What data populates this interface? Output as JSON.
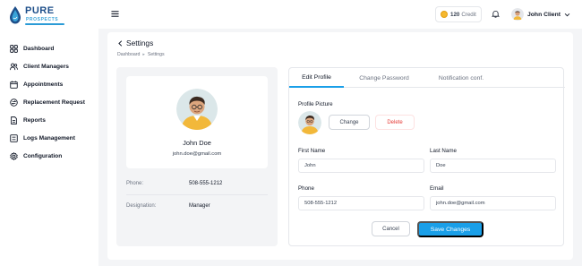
{
  "brand": {
    "name": "PURE",
    "tagline": "PROSPECTS",
    "colors": {
      "primary": "#1a9fe8",
      "brand_dark": "#1e4f8a",
      "danger": "#e53935"
    }
  },
  "sidebar": {
    "items": [
      {
        "label": "Dashboard",
        "icon": "grid-icon"
      },
      {
        "label": "Client Managers",
        "icon": "users-icon"
      },
      {
        "label": "Appointments",
        "icon": "calendar-icon"
      },
      {
        "label": "Replacement Request",
        "icon": "swap-icon"
      },
      {
        "label": "Reports",
        "icon": "document-icon"
      },
      {
        "label": "Logs Management",
        "icon": "list-icon"
      },
      {
        "label": "Configuration",
        "icon": "gear-icon"
      }
    ]
  },
  "header": {
    "credit_value": "120",
    "credit_label": "Credit",
    "user_name": "John Client"
  },
  "page": {
    "title": "Settings",
    "breadcrumb": [
      "Dashboard",
      "Settings"
    ]
  },
  "profile": {
    "name": "John Doe",
    "email": "john.doe@gmail.com",
    "phone_label": "Phone:",
    "phone": "508-555-1212",
    "designation_label": "Designation:",
    "designation": "Manager"
  },
  "tabs": [
    {
      "label": "Edit Profile",
      "active": true
    },
    {
      "label": "Change Password",
      "active": false
    },
    {
      "label": "Notification conf.",
      "active": false
    }
  ],
  "form": {
    "picture_label": "Profile Picture",
    "change_label": "Change",
    "delete_label": "Delete",
    "first_name_label": "First Name",
    "first_name_value": "John",
    "last_name_label": "Last Name",
    "last_name_value": "Doe",
    "phone_label": "Phone",
    "phone_value": "508-555-1212",
    "email_label": "Email",
    "email_value": "john.doe@gmail.com",
    "cancel_label": "Cancel",
    "save_label": "Save Changes"
  }
}
